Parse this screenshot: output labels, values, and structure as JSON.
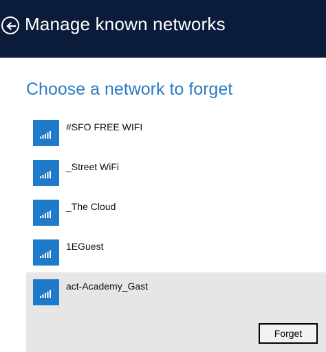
{
  "colors": {
    "header_bg": "#0b1c3b",
    "accent": "#2b7bc4",
    "tile": "#1f7ac9",
    "selected_bg": "#e6e6e6"
  },
  "header": {
    "back_icon": "back-arrow-circle-icon",
    "title": "Manage known networks"
  },
  "main": {
    "heading": "Choose a network to forget",
    "networks": [
      {
        "name": "#SFO FREE WIFI",
        "icon": "wifi-signal-icon"
      },
      {
        "name": "_Street WiFi",
        "icon": "wifi-signal-icon"
      },
      {
        "name": "_The Cloud",
        "icon": "wifi-signal-icon"
      },
      {
        "name": "1EGuest",
        "icon": "wifi-signal-icon"
      },
      {
        "name": "act-Academy_Gast",
        "icon": "wifi-signal-icon",
        "selected": true
      }
    ],
    "forget_label": "Forget"
  }
}
